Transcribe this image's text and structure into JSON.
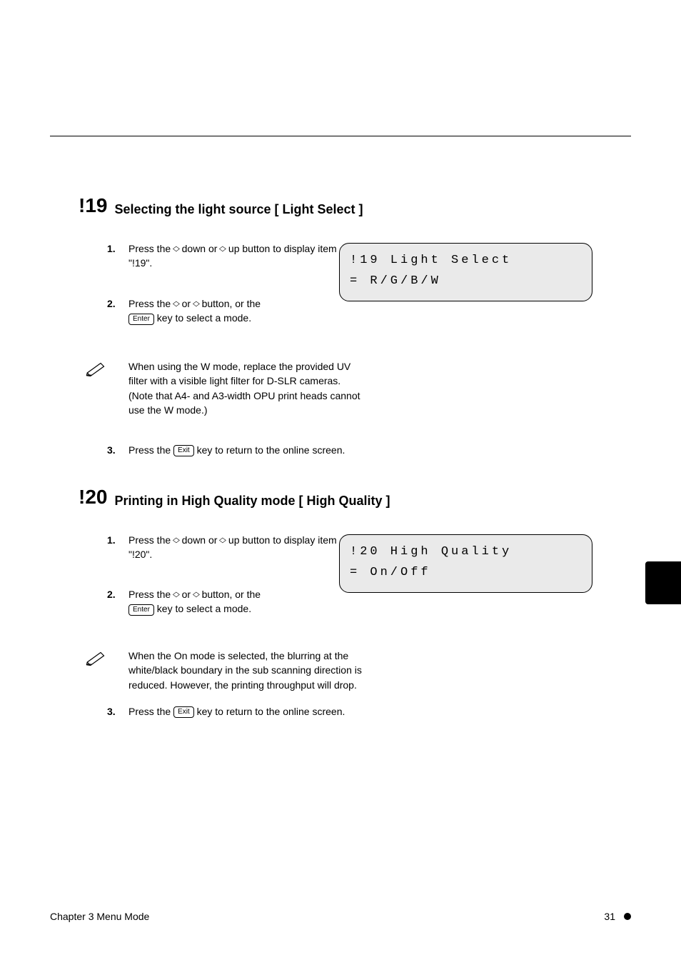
{
  "sections": {
    "s19": {
      "num": "!19",
      "title": "Selecting the light source [ Light Select ]"
    },
    "s20": {
      "num": "!20",
      "title": "Printing in High Quality mode [ High Quality ]"
    }
  },
  "steps": {
    "s19_1_num": "1.",
    "s19_1_text_a": "Press the ",
    "s19_1_text_b": " down or ",
    "s19_1_text_c": " up button to display item \"!19\".",
    "s19_2_num": "2.",
    "s19_2_text_a": "Press the ",
    "s19_2_text_b": " or ",
    "s19_2_text_c": " button, or the",
    "s19_2_text_d": " key to select a mode.",
    "s19_note_text": "When using the W mode, replace the provided UV filter with a visible light filter for D-SLR cameras. (Note that A4- and A3-width OPU print heads cannot use the W mode.)",
    "s19_3_num": "3.",
    "s19_3_text_a": "Press the ",
    "s19_3_text_b": " key to return to the online screen.",
    "s20_1_num": "1.",
    "s20_1_text_a": "Press the ",
    "s20_1_text_b": " down or ",
    "s20_1_text_c": " up button to display item \"!20\".",
    "s20_2_num": "2.",
    "s20_2_text_a": "Press the ",
    "s20_2_text_b": " or ",
    "s20_2_text_c": " button, or the",
    "s20_2_text_d": " key to select a mode.",
    "s20_note_text": "When the On mode is selected, the blurring at the white/black boundary in the sub scanning direction is reduced. However, the printing throughput will drop.",
    "s20_3_num": "3.",
    "s20_3_text_a": "Press the ",
    "s20_3_text_b": " key to return to the online screen."
  },
  "keys": {
    "enter": "Enter",
    "exit": "Exit"
  },
  "displays": {
    "d19_line1": "!19 Light Select",
    "d19_line2": "= R/G/B/W",
    "d20_line1": "!20 High Quality",
    "d20_line2": "= On/Off"
  },
  "footer": {
    "left": "Chapter 3  Menu Mode",
    "page": "31"
  }
}
